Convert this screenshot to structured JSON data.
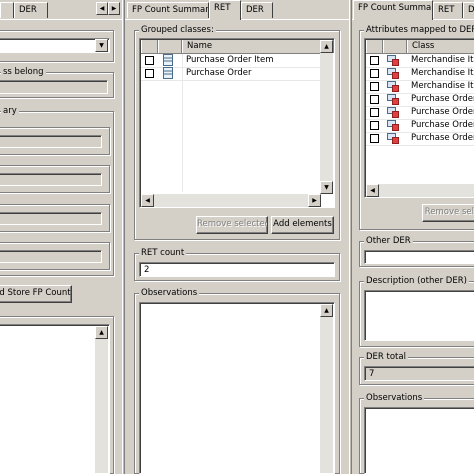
{
  "left_pane": {
    "tabs": [
      "DER"
    ],
    "class_belong_label": "ss belong",
    "summary_label": "ary",
    "store_button": "d Store FP Count"
  },
  "mid_pane": {
    "tabs": [
      "FP Count Summary",
      "RET",
      "DER"
    ],
    "grouped_label": "Grouped classes:",
    "column_name": "Name",
    "rows": [
      "Purchase Order Item",
      "Purchase Order"
    ],
    "remove_selected": "Remove selected",
    "add_elements": "Add elements",
    "ret_count_label": "RET count",
    "ret_count_value": "2",
    "observations_label": "Observations"
  },
  "right_pane": {
    "tabs": [
      "FP Count Summary",
      "RET",
      "DER"
    ],
    "attrs_label": "Attributes mapped to DERs:",
    "column_class": "Class",
    "rows": [
      "Merchandise Item",
      "Merchandise Item",
      "Merchandise Item",
      "Purchase Order",
      "Purchase Order",
      "Purchase Order",
      "Purchase Order"
    ],
    "remove_selected": "Remove sele",
    "other_der_label": "Other DER",
    "description_label": "Description (other DER)",
    "der_total_label": "DER total",
    "der_total_value": "7",
    "observations_label": "Observations"
  },
  "icons": {
    "arrow_left": "◀",
    "arrow_right": "▶",
    "arrow_up": "▲",
    "arrow_down": "▼",
    "class_icon": "class-icon",
    "attribute_icon": "attribute-icon"
  }
}
